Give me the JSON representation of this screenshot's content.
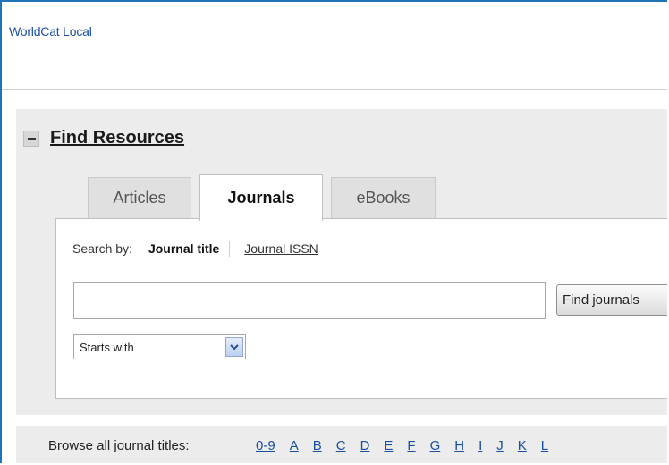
{
  "app": {
    "title": "WorldCat Local"
  },
  "section": {
    "title": "Find Resources"
  },
  "tabs": [
    {
      "label": "Articles",
      "active": false
    },
    {
      "label": "Journals",
      "active": true
    },
    {
      "label": "eBooks",
      "active": false
    }
  ],
  "search_by": {
    "label": "Search by:",
    "options": [
      "Journal title",
      "Journal ISSN"
    ],
    "selected": "Journal title"
  },
  "query": {
    "value": "",
    "placeholder": ""
  },
  "find_button": {
    "label": "Find journals"
  },
  "match_select": {
    "selected": "Starts with"
  },
  "browse": {
    "label": "Browse all journal titles:",
    "links": [
      "0-9",
      "A",
      "B",
      "C",
      "D",
      "E",
      "F",
      "G",
      "H",
      "I",
      "J",
      "K",
      "L"
    ]
  },
  "colors": {
    "frame_border": "#1f73b7",
    "link": "#1a4fa0",
    "panel_bg": "#ececec"
  },
  "icons": {
    "collapse": "minus-icon",
    "dropdown": "chevron-down-icon"
  }
}
